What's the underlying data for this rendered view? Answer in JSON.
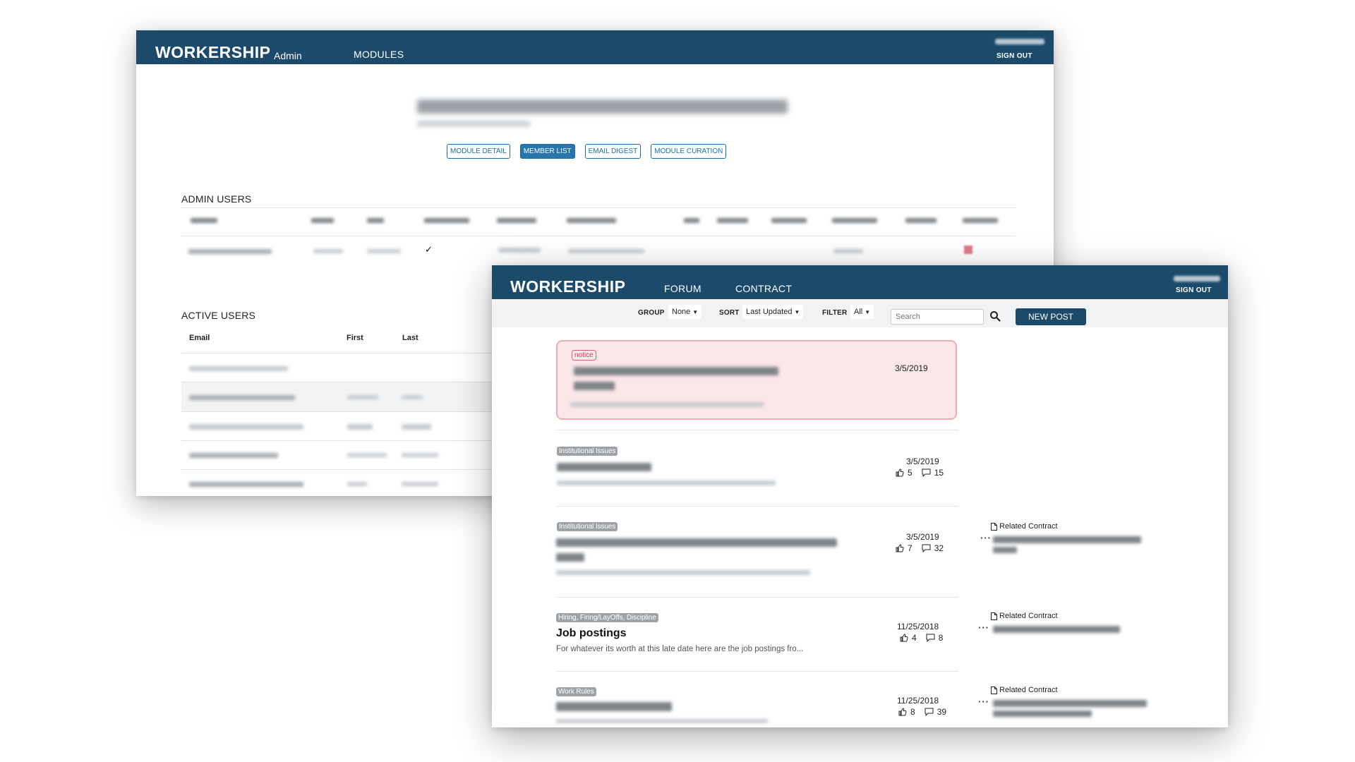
{
  "admin_window": {
    "brand": "WORKERSHIP",
    "brand_suffix": "Admin",
    "nav_modules": "MODULES",
    "sign_out": "SIGN OUT",
    "tabs": [
      "MODULE DETAIL",
      "MEMBER LIST",
      "EMAIL DIGEST",
      "MODULE CURATION"
    ],
    "active_tab": "MEMBER LIST",
    "admin_users_label": "ADMIN USERS",
    "active_users_label": "ACTIVE USERS",
    "active_headers": {
      "email": "Email",
      "first": "First",
      "last": "Last"
    }
  },
  "forum_window": {
    "brand": "WORKERSHIP",
    "nav_forum": "FORUM",
    "nav_contract": "CONTRACT",
    "sign_out": "SIGN OUT",
    "toolbar": {
      "group_label": "GROUP",
      "group_value": "None",
      "sort_label": "SORT",
      "sort_value": "Last Updated",
      "filter_label": "FILTER",
      "filter_value": "All",
      "search_placeholder": "Search",
      "new_post": "NEW POST"
    },
    "notice": {
      "tag": "notice",
      "date": "3/5/2019"
    },
    "posts": [
      {
        "tag": "Institutional Issues",
        "date": "3/5/2019",
        "likes": "5",
        "comments": "15"
      },
      {
        "tag": "Institutional Issues",
        "date": "3/5/2019",
        "likes": "7",
        "comments": "32",
        "related": "Related Contract"
      },
      {
        "tag": "Hiring, Firing/LayOffs, Discipline",
        "title": "Job postings",
        "excerpt": "For whatever its worth at this late date here are the job postings fro...",
        "date": "11/25/2018",
        "likes": "4",
        "comments": "8",
        "related": "Related Contract"
      },
      {
        "tag": "Work Rules",
        "date": "11/25/2018",
        "likes": "8",
        "comments": "39",
        "related": "Related Contract"
      }
    ],
    "colors": {
      "navbar": "#1b4a6b",
      "notice_bg": "#fbe6e8",
      "notice_border": "#f2a9b2"
    }
  }
}
